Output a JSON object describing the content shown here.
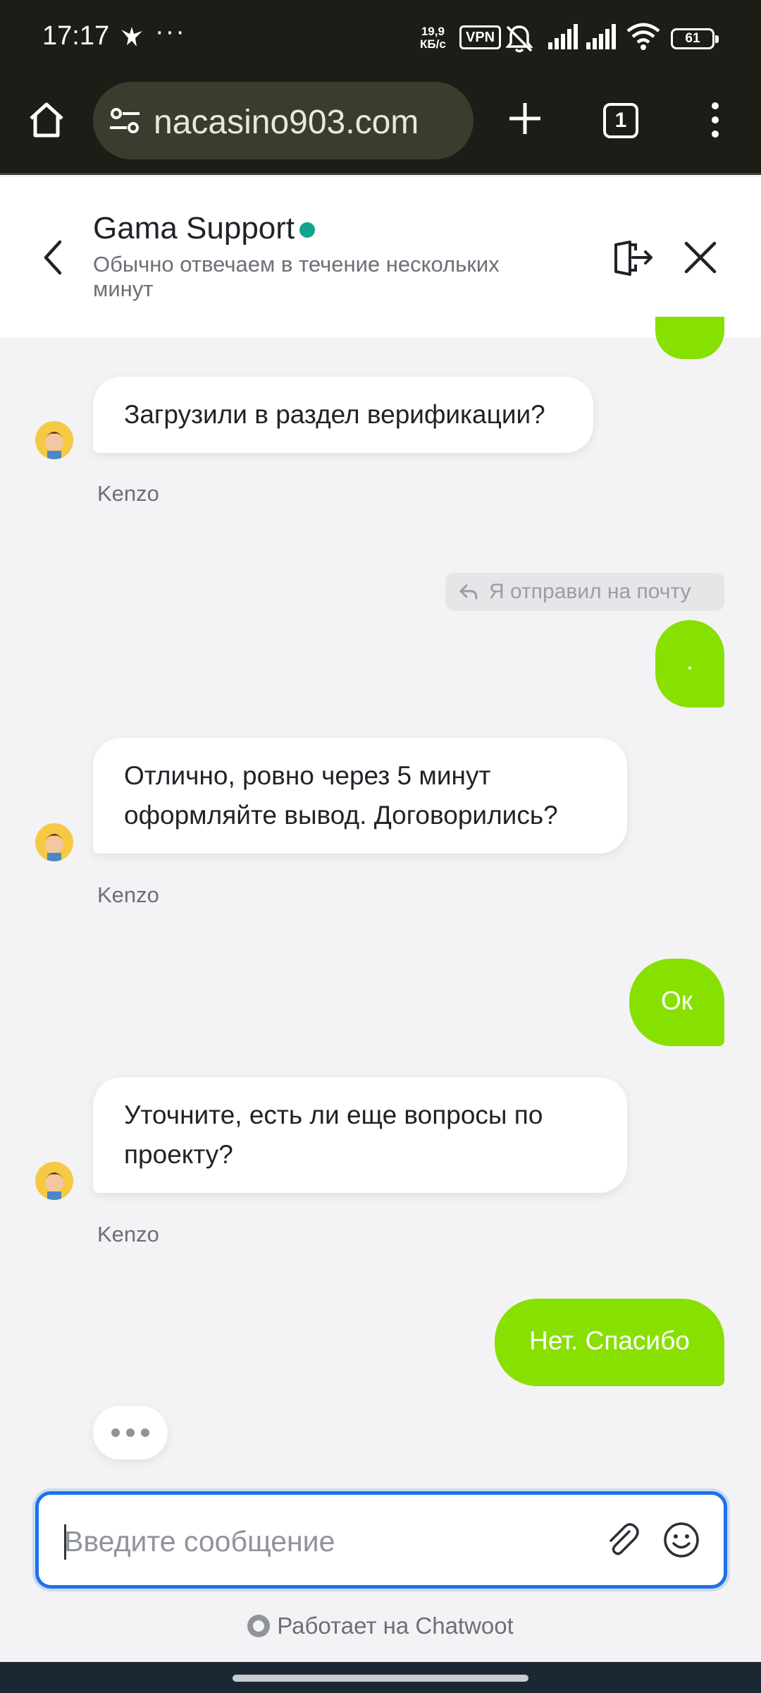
{
  "status_bar": {
    "time": "17:17",
    "more": "···",
    "net_speed_value": "19,9",
    "net_speed_unit": "КБ/с",
    "vpn": "VPN",
    "battery": "61"
  },
  "browser": {
    "url": "nacasino903.com",
    "tab_count": "1"
  },
  "chat": {
    "title": "Gama Support",
    "subtitle": "Обычно отвечаем в течение нескольких минут",
    "online_color": "#14a38b"
  },
  "messages": [
    {
      "side": "in",
      "text": "Загрузили в раздел верификации?",
      "sender": "Kenzo"
    },
    {
      "side": "out",
      "reply_to": "Я отправил на почту",
      "text": "."
    },
    {
      "side": "in",
      "text": "Отлично, ровно через 5 минут оформляйте вывод. Договорились?",
      "sender": "Kenzo"
    },
    {
      "side": "out",
      "text": "Ок"
    },
    {
      "side": "in",
      "text": "Уточните, есть ли еще вопросы по проекту?",
      "sender": "Kenzo"
    },
    {
      "side": "out",
      "text": "Нет. Спасибо"
    }
  ],
  "composer": {
    "placeholder": "Введите сообщение"
  },
  "footer": {
    "powered_by": "Работает на Chatwoot"
  },
  "colors": {
    "outgoing_bubble": "#88e001",
    "accent_focus": "#1e72e8",
    "browser_chrome": "#1b1d16"
  }
}
